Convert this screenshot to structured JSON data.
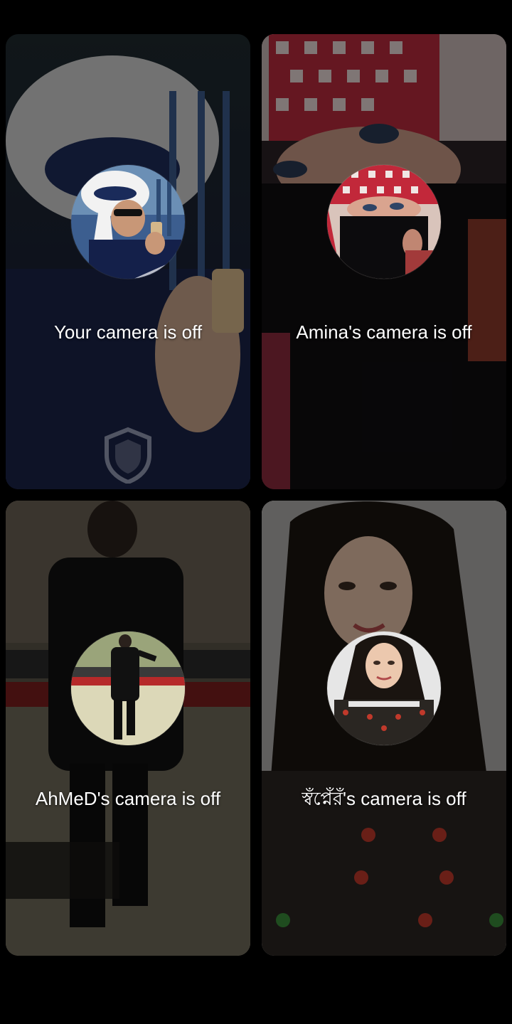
{
  "participants": [
    {
      "camera_status": "Your camera is off",
      "avatar_icon": "user-avatar-man-headscarf"
    },
    {
      "camera_status": "Amina's camera is off",
      "avatar_icon": "user-avatar-woman-niqab"
    },
    {
      "camera_status": "AhMeD's camera is off",
      "avatar_icon": "user-avatar-man-black-outfit"
    },
    {
      "camera_status": "স্বঁপ্নেঁরঁ's camera is off",
      "avatar_icon": "user-avatar-woman-hijab"
    }
  ],
  "colors": {
    "background": "#000000",
    "text": "#ffffff"
  }
}
